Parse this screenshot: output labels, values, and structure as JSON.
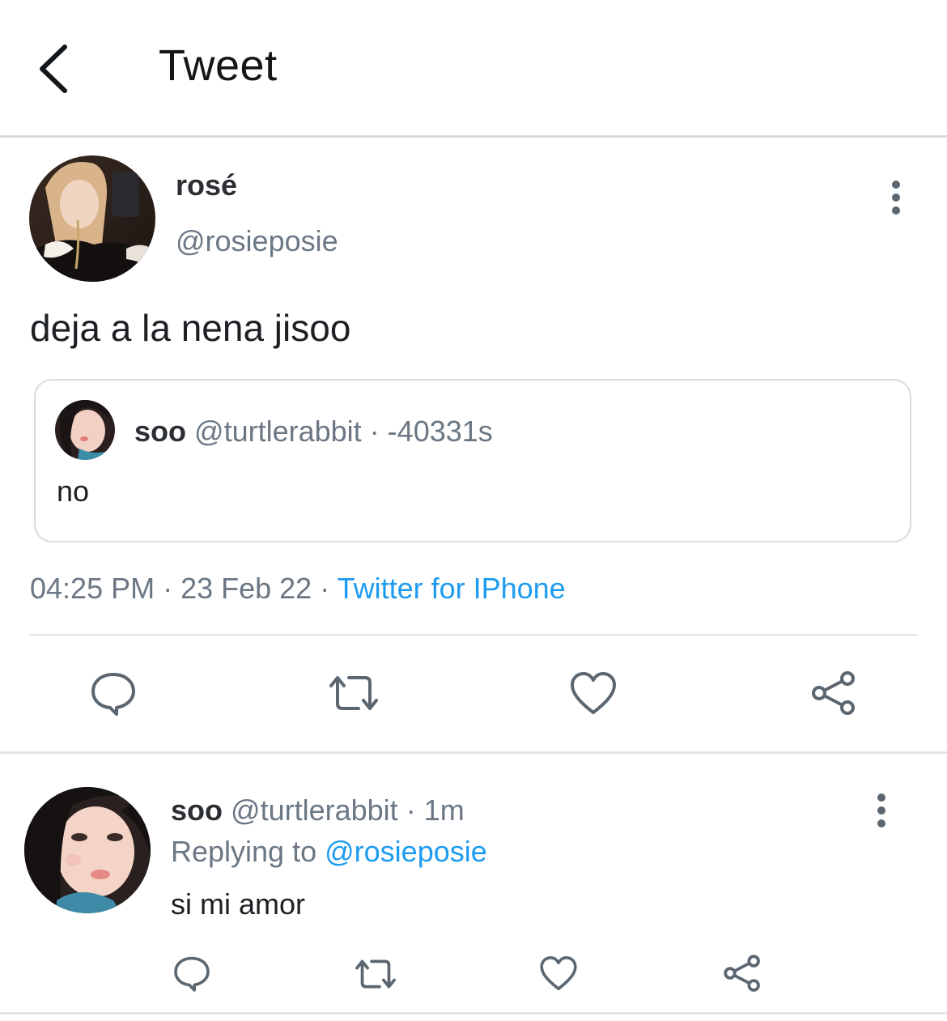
{
  "header": {
    "title": "Tweet",
    "back_icon": "back-arrow-icon"
  },
  "tweet": {
    "display_name": "rosé",
    "handle": "@rosieposie",
    "text": "deja a la nena jisoo",
    "timestamp": "04:25 PM · 23 Feb 22 ·",
    "source": "Twitter for IPhone",
    "quote": {
      "display_name": "soo",
      "handle": "@turtlerabbit",
      "time": "· -40331s",
      "text": "no"
    },
    "actions": [
      "reply-icon",
      "retweet-icon",
      "like-icon",
      "share-icon"
    ]
  },
  "reply": {
    "display_name": "soo",
    "handle": "@turtlerabbit",
    "time": "· 1m",
    "replying_label": "Replying to",
    "replying_to": "@rosieposie",
    "text": "si mi amor",
    "actions": [
      "reply-icon",
      "retweet-icon",
      "like-icon",
      "share-icon"
    ]
  },
  "colors": {
    "accent": "#1d9bf0",
    "secondary_text": "#6b7785",
    "icon": "#5b6670",
    "divider": "#e1e6ea"
  }
}
